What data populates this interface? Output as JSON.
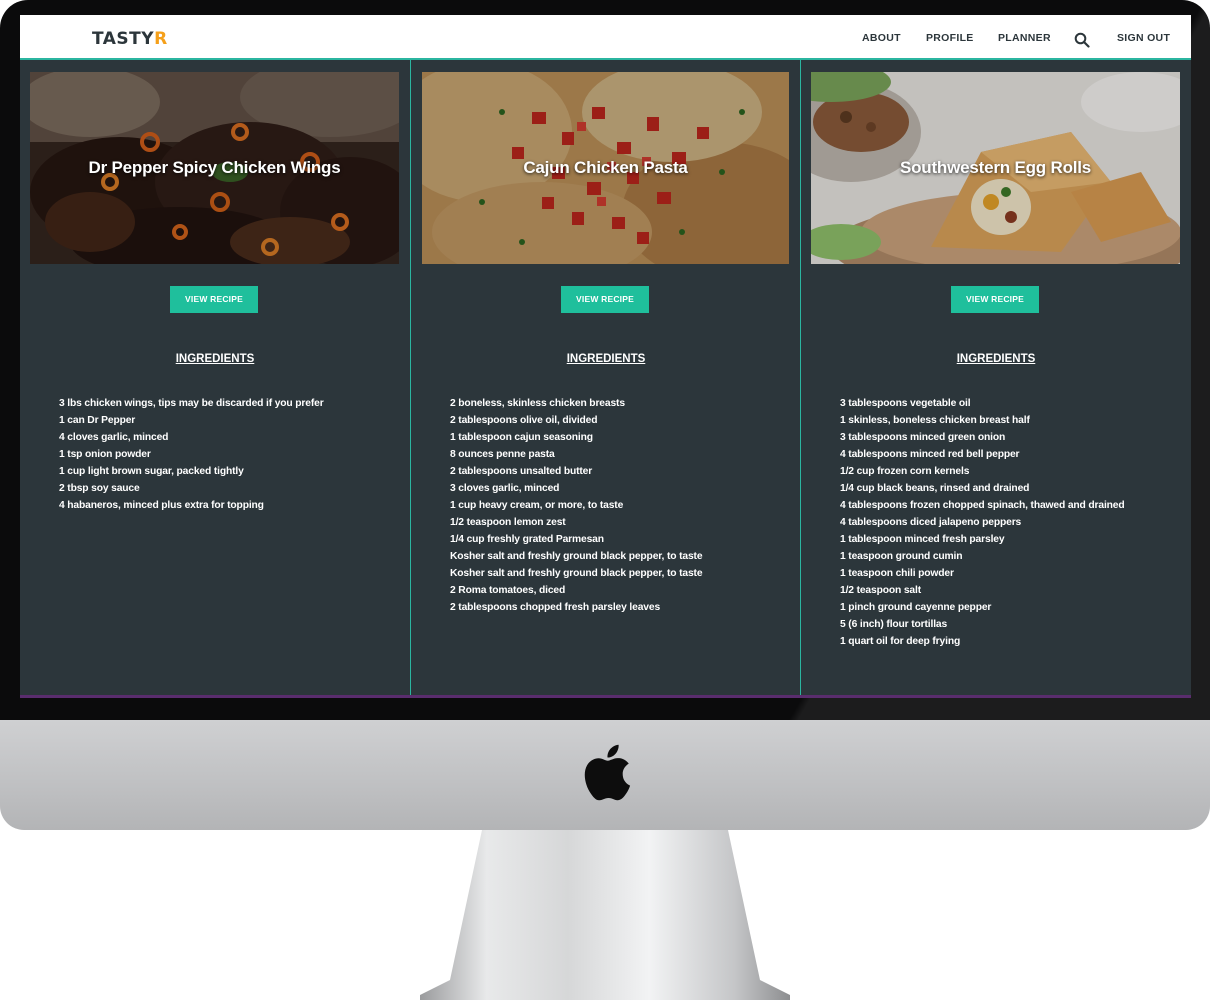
{
  "brand": {
    "name": "TASTY",
    "accent": "R"
  },
  "nav": {
    "about": "ABOUT",
    "profile": "PROFILE",
    "planner": "PLANNER",
    "search_icon": "search-icon",
    "sign_out": "SIGN OUT"
  },
  "colors": {
    "screen_bg": "#2c363b",
    "accent_teal": "#1fbf9c",
    "brand_orange": "#f5a01a"
  },
  "recipes": [
    {
      "title": "Dr Pepper Spicy Chicken Wings",
      "button": "VIEW RECIPE",
      "ingredients_heading": "INGREDIENTS",
      "ingredients": [
        "3 lbs chicken wings, tips may be discarded if you prefer",
        "1 can Dr Pepper",
        "4 cloves garlic, minced",
        "1 tsp onion powder",
        "1 cup light brown sugar, packed tightly",
        "2 tbsp soy sauce",
        "4 habaneros, minced plus extra for topping"
      ]
    },
    {
      "title": "Cajun Chicken Pasta",
      "button": "VIEW RECIPE",
      "ingredients_heading": "INGREDIENTS",
      "ingredients": [
        "2 boneless, skinless chicken breasts",
        "2 tablespoons olive oil, divided",
        "1 tablespoon cajun seasoning",
        "8 ounces penne pasta",
        "2 tablespoons unsalted butter",
        "3 cloves garlic, minced",
        "1 cup heavy cream, or more, to taste",
        "1/2 teaspoon lemon zest",
        "1/4 cup freshly grated Parmesan",
        "Kosher salt and freshly ground black pepper, to taste",
        "Kosher salt and freshly ground black pepper, to taste",
        "2 Roma tomatoes, diced",
        "2 tablespoons chopped fresh parsley leaves"
      ]
    },
    {
      "title": "Southwestern Egg Rolls",
      "button": "VIEW RECIPE",
      "ingredients_heading": "INGREDIENTS",
      "ingredients": [
        "3 tablespoons vegetable oil",
        "1 skinless, boneless chicken breast half",
        "3 tablespoons minced green onion",
        "4 tablespoons minced red bell pepper",
        "1/2 cup frozen corn kernels",
        "1/4 cup black beans, rinsed and drained",
        "4 tablespoons frozen chopped spinach, thawed and drained",
        "4 tablespoons diced jalapeno peppers",
        "1 tablespoon minced fresh parsley",
        "1 teaspoon ground cumin",
        "1 teaspoon chili powder",
        "1/2 teaspoon salt",
        "1 pinch ground cayenne pepper",
        "5 (6 inch) flour tortillas",
        "1 quart oil for deep frying"
      ]
    }
  ]
}
